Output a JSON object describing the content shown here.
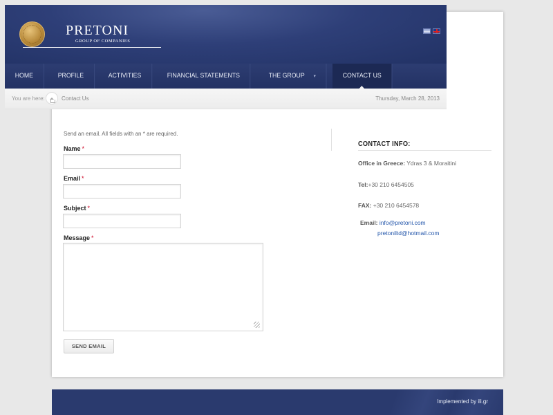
{
  "brand": {
    "name": "PRETONI",
    "subtitle": "GROUP OF COMPANIES"
  },
  "flags": {
    "greek_icon": "greek-flag-icon",
    "english_icon": "uk-flag-icon"
  },
  "nav": {
    "items": [
      {
        "label": "HOME"
      },
      {
        "label": "PROFILE"
      },
      {
        "label": "ACTIVITIES"
      },
      {
        "label": "FINANCIAL STATEMENTS"
      },
      {
        "label": "THE GROUP",
        "caret": "▾"
      },
      {
        "label": "CONTACT US",
        "active": true
      }
    ]
  },
  "breadcrumb": {
    "label": "You are here:",
    "current": "Contact Us",
    "date": "Thursday, March 28, 2013"
  },
  "form": {
    "intro": "Send an email. All fields with an * are required.",
    "required_mark": "*",
    "name_label": "Name",
    "email_label": "Email",
    "subject_label": "Subject",
    "message_label": "Message",
    "name_value": "",
    "email_value": "",
    "subject_value": "",
    "message_value": "",
    "send_label": "SEND EMAIL"
  },
  "contact": {
    "title": "CONTACT INFO:",
    "office_label": "Office in Greece:",
    "office_value": " Ydras 3 & Moraitini",
    "tel_label": "Tel:",
    "tel_value": "+30 210 6454505",
    "fax_label": "FAX:",
    "fax_value": " +30 210 6454578",
    "email_label": "Email:",
    "email_1": "info@pretoni.com",
    "email_2": "pretoniltd@hotmail.com"
  },
  "footer": {
    "text": "Implemented by ili.gr"
  },
  "colors": {
    "header_blue": "#2e3f78",
    "link_blue": "#2255aa",
    "required_red": "#cc0022"
  }
}
